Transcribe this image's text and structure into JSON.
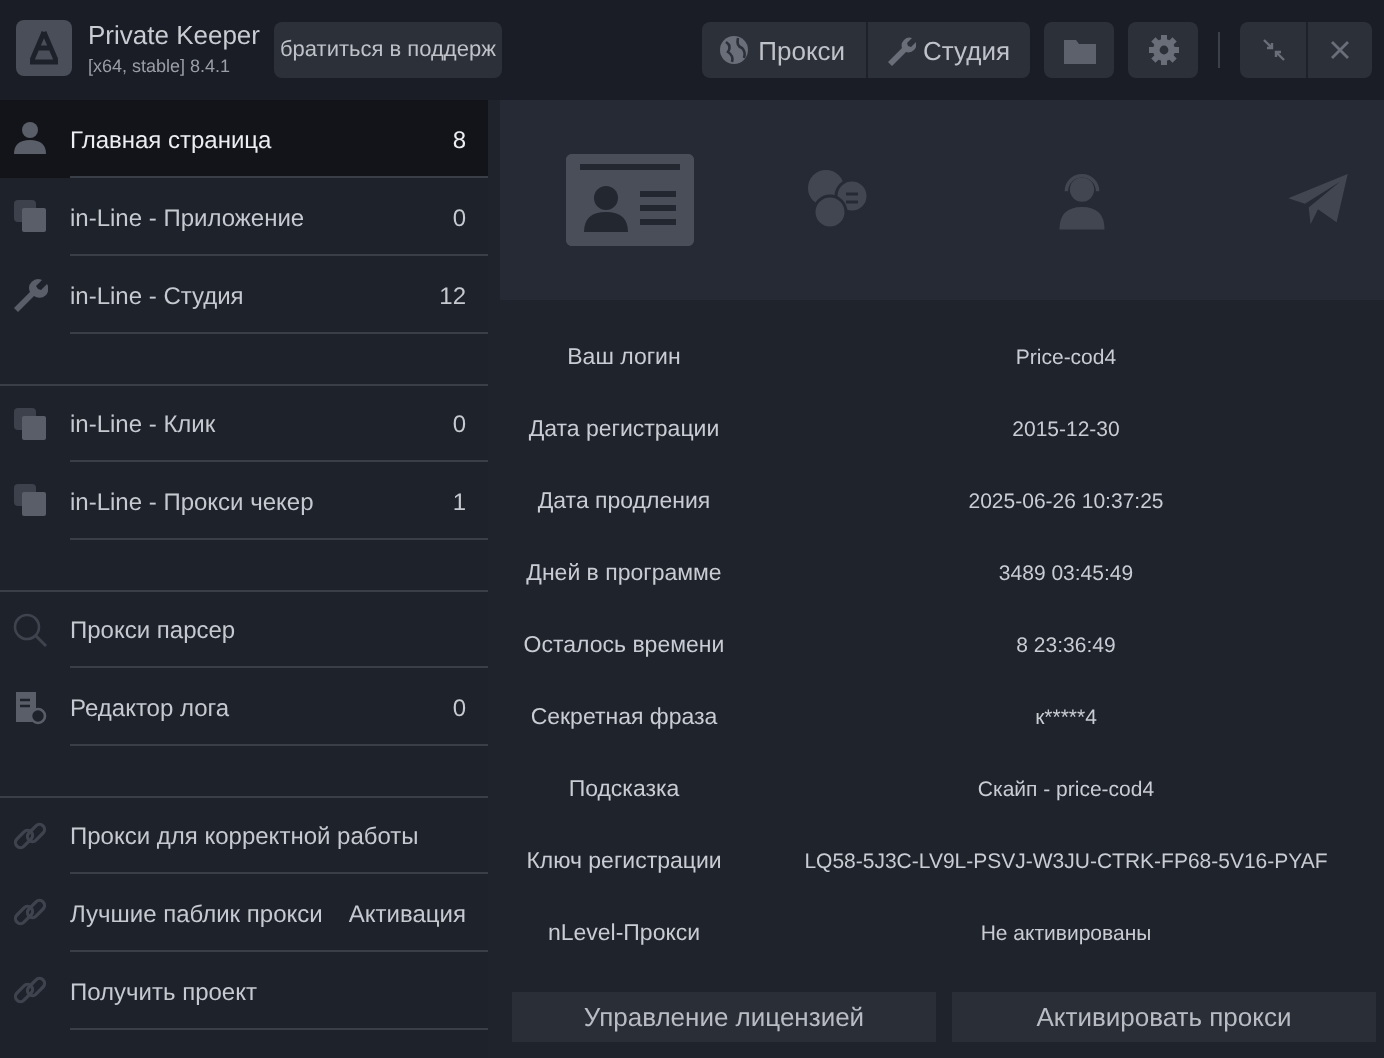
{
  "app": {
    "title": "Private Keeper",
    "version": "[x64, stable] 8.4.1"
  },
  "support_button": "братиться в поддерж",
  "toolbar": {
    "segments": [
      "Прокси",
      "Студия"
    ]
  },
  "sidebar": {
    "groups": [
      {
        "items": [
          {
            "label": "Главная страница",
            "count": "8",
            "selected": true
          },
          {
            "label": "in-Line - Приложение",
            "count": "0",
            "selected": false
          },
          {
            "label": "in-Line - Студия",
            "count": "12",
            "selected": false
          }
        ]
      },
      {
        "items": [
          {
            "label": "in-Line - Клик",
            "count": "0",
            "selected": false
          },
          {
            "label": "in-Line - Прокси чекер",
            "count": "1",
            "selected": false
          }
        ]
      },
      {
        "items": [
          {
            "label": "Прокси парсер",
            "selected": false
          },
          {
            "label": "Редактор лога",
            "count": "0",
            "selected": false
          }
        ]
      },
      {
        "items": [
          {
            "label": "Прокси для корректной работы",
            "selected": false
          },
          {
            "label": "Лучшие паблик прокси",
            "action": "Активация",
            "selected": false
          },
          {
            "label": "Получить проект",
            "selected": false
          }
        ]
      }
    ]
  },
  "main": {
    "tabs": [
      {
        "selected": true
      },
      {
        "selected": false
      },
      {
        "selected": false
      },
      {
        "selected": false
      }
    ],
    "info": [
      {
        "label": "Ваш логин",
        "value": "Price-cod4"
      },
      {
        "label": "Дата регистрации",
        "value": "2015-12-30"
      },
      {
        "label": "Дата продления",
        "value": "2025-06-26 10:37:25"
      },
      {
        "label": "Дней в программе",
        "value": "3489 03:45:49"
      },
      {
        "label": "Осталось времени",
        "value": "8 23:36:49"
      },
      {
        "label": "Секретная фраза",
        "value": "к*****4"
      },
      {
        "label": "Подсказка",
        "value": "Скайп - price-cod4"
      },
      {
        "label": "Ключ регистрации",
        "value": "LQ58-5J3C-LV9L-PSVJ-W3JU-CTRK-FP68-5V16-PYAF"
      },
      {
        "label": "nLevel-Прокси",
        "value": "Не активированы"
      }
    ],
    "buttons": [
      "Управление лицензией",
      "Активировать прокси"
    ]
  }
}
